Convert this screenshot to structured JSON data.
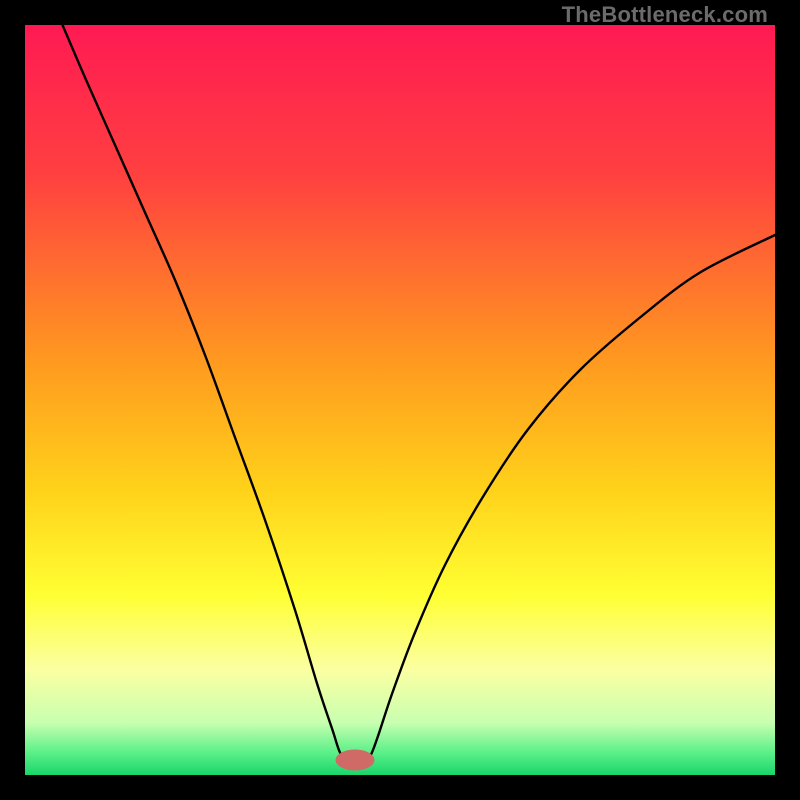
{
  "watermark": "TheBottleneck.com",
  "chart_data": {
    "type": "line",
    "title": "",
    "xlabel": "",
    "ylabel": "",
    "xlim": [
      0,
      100
    ],
    "ylim": [
      0,
      100
    ],
    "grid": false,
    "legend": false,
    "background_gradient": {
      "stops": [
        {
          "offset": 0.0,
          "color": "#ff1a53"
        },
        {
          "offset": 0.2,
          "color": "#ff4040"
        },
        {
          "offset": 0.45,
          "color": "#ff9a1f"
        },
        {
          "offset": 0.62,
          "color": "#ffd21a"
        },
        {
          "offset": 0.76,
          "color": "#ffff33"
        },
        {
          "offset": 0.86,
          "color": "#fbffa2"
        },
        {
          "offset": 0.93,
          "color": "#c8ffb0"
        },
        {
          "offset": 0.97,
          "color": "#5cf089"
        },
        {
          "offset": 1.0,
          "color": "#18d66a"
        }
      ]
    },
    "curve_color": "#000000",
    "marker": {
      "x": 44,
      "y": 2,
      "color": "#cf6a66",
      "rx": 2.6,
      "ry": 1.4
    },
    "curve_points": [
      {
        "x": 5,
        "y": 100
      },
      {
        "x": 8,
        "y": 93
      },
      {
        "x": 12,
        "y": 84
      },
      {
        "x": 16,
        "y": 75
      },
      {
        "x": 20,
        "y": 66
      },
      {
        "x": 24,
        "y": 56
      },
      {
        "x": 28,
        "y": 45
      },
      {
        "x": 32,
        "y": 34
      },
      {
        "x": 36,
        "y": 22
      },
      {
        "x": 39,
        "y": 12
      },
      {
        "x": 41,
        "y": 6
      },
      {
        "x": 42,
        "y": 3
      },
      {
        "x": 43,
        "y": 2
      },
      {
        "x": 45,
        "y": 2
      },
      {
        "x": 46,
        "y": 2.5
      },
      {
        "x": 47,
        "y": 5
      },
      {
        "x": 49,
        "y": 11
      },
      {
        "x": 52,
        "y": 19
      },
      {
        "x": 56,
        "y": 28
      },
      {
        "x": 61,
        "y": 37
      },
      {
        "x": 67,
        "y": 46
      },
      {
        "x": 74,
        "y": 54
      },
      {
        "x": 82,
        "y": 61
      },
      {
        "x": 90,
        "y": 67
      },
      {
        "x": 100,
        "y": 72
      }
    ]
  }
}
